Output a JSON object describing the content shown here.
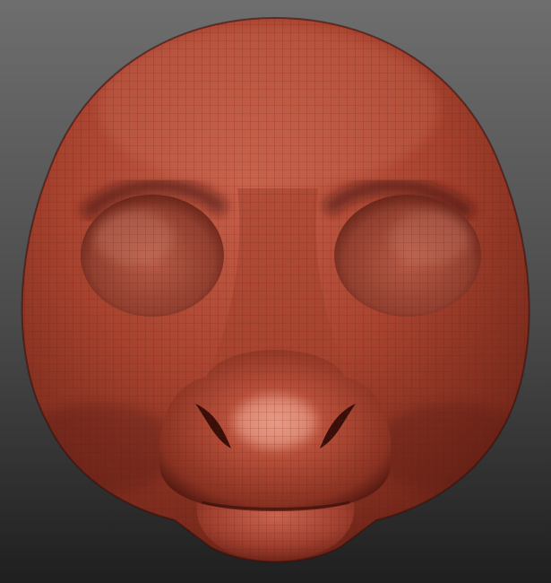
{
  "scene": {
    "subject": "sculpted-head-mesh",
    "background": {
      "top_color": "#6e6e6e",
      "bottom_color": "#1f1f1f"
    },
    "material": {
      "base_color": "#a8432f",
      "shadow_color": "#4e1710",
      "highlight_color": "#e0907c",
      "wireframe_color": "#5a1c12"
    }
  }
}
